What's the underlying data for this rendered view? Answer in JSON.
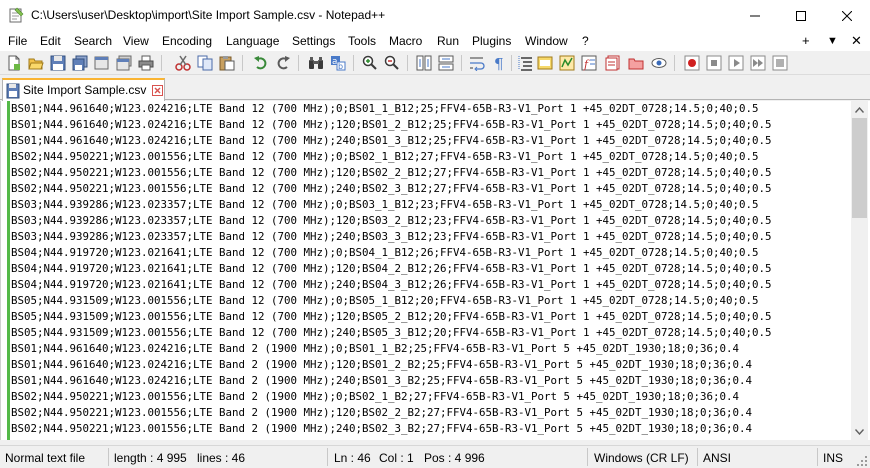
{
  "window": {
    "title": "C:\\Users\\user\\Desktop\\import\\Site Import Sample.csv - Notepad++"
  },
  "menu": {
    "items": [
      "File",
      "Edit",
      "Search",
      "View",
      "Encoding",
      "Language",
      "Settings",
      "Tools",
      "Macro",
      "Run",
      "Plugins",
      "Window",
      "?"
    ],
    "right": [
      "+",
      "▼",
      "✕"
    ]
  },
  "toolbar": {
    "icons": [
      "new-file-icon",
      "open-file-icon",
      "save-icon",
      "save-all-icon",
      "close-icon",
      "close-all-icon",
      "print-icon",
      "cut-icon",
      "copy-icon",
      "paste-icon",
      "undo-icon",
      "redo-icon",
      "find-icon",
      "replace-icon",
      "zoom-in-icon",
      "zoom-out-icon",
      "sync-vertical-icon",
      "sync-horizontal-icon",
      "word-wrap-icon",
      "show-all-chars-icon",
      "indent-guide-icon",
      "udl-icon",
      "doc-map-icon",
      "function-list-icon",
      "folder-workspace-icon",
      "monitoring-icon",
      "record-macro-icon",
      "stop-macro-icon",
      "play-macro-icon",
      "run-macro-multiple-icon",
      "save-macro-icon"
    ]
  },
  "tab": {
    "label": "Site Import Sample.csv"
  },
  "editor": {
    "lines": [
      "BS01;N44.961640;W123.024216;LTE Band 12 (700 MHz);0;BS01_1_B12;25;FFV4-65B-R3-V1_Port 1 +45_02DT_0728;14.5;0;40;0.5",
      "BS01;N44.961640;W123.024216;LTE Band 12 (700 MHz);120;BS01_2_B12;25;FFV4-65B-R3-V1_Port 1 +45_02DT_0728;14.5;0;40;0.5",
      "BS01;N44.961640;W123.024216;LTE Band 12 (700 MHz);240;BS01_3_B12;25;FFV4-65B-R3-V1_Port 1 +45_02DT_0728;14.5;0;40;0.5",
      "BS02;N44.950221;W123.001556;LTE Band 12 (700 MHz);0;BS02_1_B12;27;FFV4-65B-R3-V1_Port 1 +45_02DT_0728;14.5;0;40;0.5",
      "BS02;N44.950221;W123.001556;LTE Band 12 (700 MHz);120;BS02_2_B12;27;FFV4-65B-R3-V1_Port 1 +45_02DT_0728;14.5;0;40;0.5",
      "BS02;N44.950221;W123.001556;LTE Band 12 (700 MHz);240;BS02_3_B12;27;FFV4-65B-R3-V1_Port 1 +45_02DT_0728;14.5;0;40;0.5",
      "BS03;N44.939286;W123.023357;LTE Band 12 (700 MHz);0;BS03_1_B12;23;FFV4-65B-R3-V1_Port 1 +45_02DT_0728;14.5;0;40;0.5",
      "BS03;N44.939286;W123.023357;LTE Band 12 (700 MHz);120;BS03_2_B12;23;FFV4-65B-R3-V1_Port 1 +45_02DT_0728;14.5;0;40;0.5",
      "BS03;N44.939286;W123.023357;LTE Band 12 (700 MHz);240;BS03_3_B12;23;FFV4-65B-R3-V1_Port 1 +45_02DT_0728;14.5;0;40;0.5",
      "BS04;N44.919720;W123.021641;LTE Band 12 (700 MHz);0;BS04_1_B12;26;FFV4-65B-R3-V1_Port 1 +45_02DT_0728;14.5;0;40;0.5",
      "BS04;N44.919720;W123.021641;LTE Band 12 (700 MHz);120;BS04_2_B12;26;FFV4-65B-R3-V1_Port 1 +45_02DT_0728;14.5;0;40;0.5",
      "BS04;N44.919720;W123.021641;LTE Band 12 (700 MHz);240;BS04_3_B12;26;FFV4-65B-R3-V1_Port 1 +45_02DT_0728;14.5;0;40;0.5",
      "BS05;N44.931509;W123.001556;LTE Band 12 (700 MHz);0;BS05_1_B12;20;FFV4-65B-R3-V1_Port 1 +45_02DT_0728;14.5;0;40;0.5",
      "BS05;N44.931509;W123.001556;LTE Band 12 (700 MHz);120;BS05_2_B12;20;FFV4-65B-R3-V1_Port 1 +45_02DT_0728;14.5;0;40;0.5",
      "BS05;N44.931509;W123.001556;LTE Band 12 (700 MHz);240;BS05_3_B12;20;FFV4-65B-R3-V1_Port 1 +45_02DT_0728;14.5;0;40;0.5",
      "BS01;N44.961640;W123.024216;LTE Band 2 (1900 MHz);0;BS01_1_B2;25;FFV4-65B-R3-V1_Port 5 +45_02DT_1930;18;0;36;0.4",
      "BS01;N44.961640;W123.024216;LTE Band 2 (1900 MHz);120;BS01_2_B2;25;FFV4-65B-R3-V1_Port 5 +45_02DT_1930;18;0;36;0.4",
      "BS01;N44.961640;W123.024216;LTE Band 2 (1900 MHz);240;BS01_3_B2;25;FFV4-65B-R3-V1_Port 5 +45_02DT_1930;18;0;36;0.4",
      "BS02;N44.950221;W123.001556;LTE Band 2 (1900 MHz);0;BS02_1_B2;27;FFV4-65B-R3-V1_Port 5 +45_02DT_1930;18;0;36;0.4",
      "BS02;N44.950221;W123.001556;LTE Band 2 (1900 MHz);120;BS02_2_B2;27;FFV4-65B-R3-V1_Port 5 +45_02DT_1930;18;0;36;0.4",
      "BS02;N44.950221;W123.001556;LTE Band 2 (1900 MHz);240;BS02_3_B2;27;FFV4-65B-R3-V1_Port 5 +45_02DT_1930;18;0;36;0.4"
    ]
  },
  "status": {
    "doc_type": "Normal text file",
    "length": "length : 4 995",
    "lines": "lines : 46",
    "ln": "Ln : 46",
    "col": "Col : 1",
    "pos": "Pos : 4 996",
    "eol": "Windows (CR LF)",
    "encoding": "ANSI",
    "ins": "INS"
  },
  "colors": {
    "tab_accent": "#fab432",
    "change_marker": "#54b948",
    "close_red": "#d9534f"
  }
}
